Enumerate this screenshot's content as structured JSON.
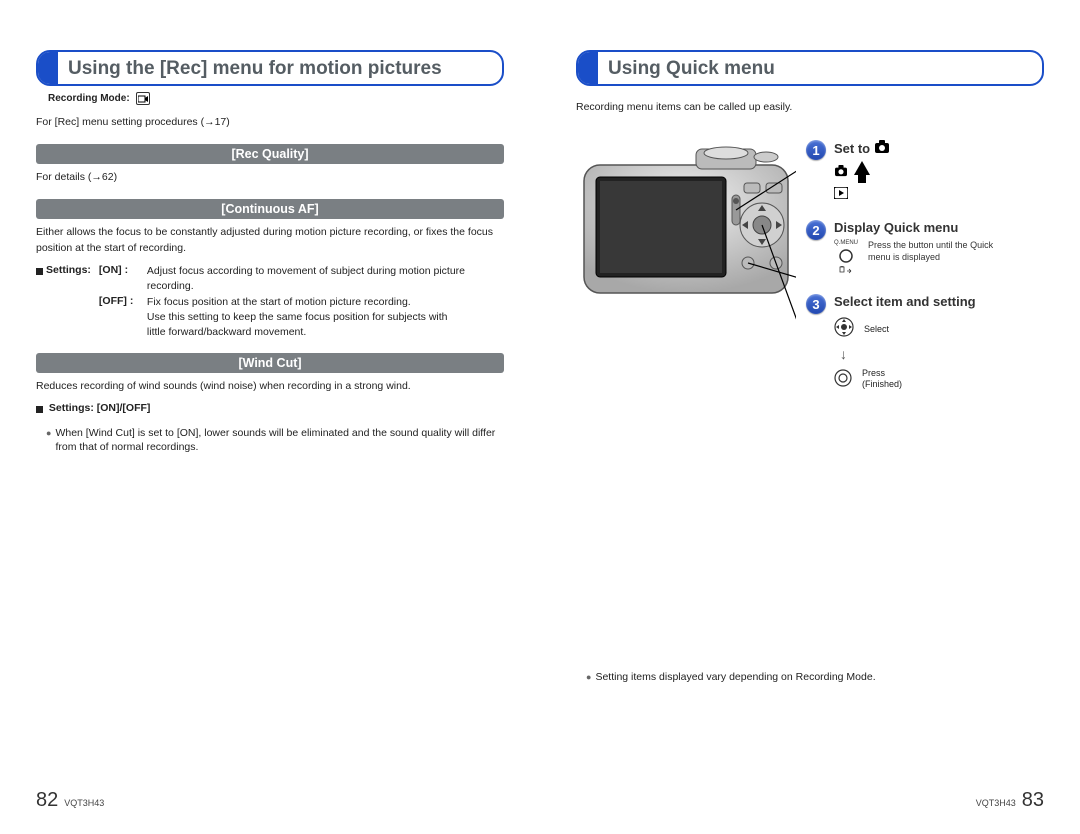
{
  "left": {
    "title": "Using the [Rec] menu for motion pictures",
    "recmode_label": "Recording Mode:",
    "intro": "For [Rec] menu setting procedures (→17)",
    "sec1": {
      "header": "[Rec Quality]",
      "body": "For details (→62)"
    },
    "sec2": {
      "header": "[Continuous AF]",
      "body": "Either allows the focus to be constantly adjusted during motion picture recording, or fixes the focus position at the start of recording.",
      "settings_label": "Settings:",
      "on_label": "[ON]  :",
      "on_text": "Adjust focus according to movement of subject during motion picture recording.",
      "off_label": "[OFF] :",
      "off_text": "Fix focus position at the start of motion picture recording.\nUse this setting to keep the same focus position for subjects with little forward/backward movement."
    },
    "sec3": {
      "header": "[Wind Cut]",
      "body": "Reduces recording of wind sounds (wind noise) when recording in a strong wind.",
      "settings_line": "Settings: [ON]/[OFF]",
      "note": "When [Wind Cut] is set to [ON], lower sounds will be eliminated and the sound quality will differ from that of normal recordings."
    },
    "pagenum": "82",
    "docid": "VQT3H43"
  },
  "right": {
    "title": "Using Quick menu",
    "intro": "Recording menu items can be called up easily.",
    "step1": {
      "title": "Set to"
    },
    "step2": {
      "title": "Display Quick menu",
      "btn_label": "Q.MENU",
      "btn_sub": "",
      "desc": "Press the button until the Quick menu is displayed"
    },
    "step3": {
      "title": "Select item and setting",
      "select": "Select",
      "arrow": "↓",
      "press": "Press\n(Finished)"
    },
    "note": "Setting items displayed vary depending on Recording Mode.",
    "pagenum": "83",
    "docid": "VQT3H43"
  }
}
